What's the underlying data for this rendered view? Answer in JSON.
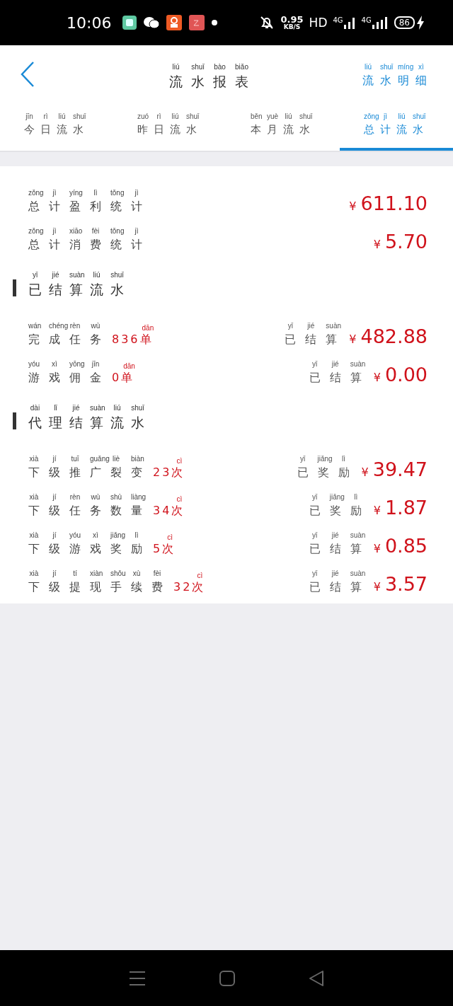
{
  "status_bar": {
    "time": "10:06",
    "speed": "0.95",
    "speed_unit": "KB/S",
    "hd": "HD",
    "network_1": "4G",
    "network_2": "4G",
    "battery": "86"
  },
  "header": {
    "title": {
      "text": "流水报表",
      "pinyin": "liú shuǐ bào biǎo"
    },
    "action": {
      "text": "流水明细",
      "pinyin": "liú shuǐ míng xì"
    }
  },
  "tabs": [
    {
      "text": "今日流水",
      "pinyin": "jīn rì liú shuǐ",
      "selected": false
    },
    {
      "text": "昨日流水",
      "pinyin": "zuó rì liú shuǐ",
      "selected": false
    },
    {
      "text": "本月流水",
      "pinyin": "běn yuè liú shuǐ",
      "selected": false
    },
    {
      "text": "总计流水",
      "pinyin": "zǒng jì liú shuǐ",
      "selected": true
    }
  ],
  "totals": [
    {
      "label": {
        "text": "总计盈利统计",
        "pinyin": "zǒng jì yíng lì tǒng jì"
      },
      "amount": {
        "currency": "¥",
        "value": "611.10"
      }
    },
    {
      "label": {
        "text": "总计消费统计",
        "pinyin": "zǒng jì xiāo fèi tǒng jì"
      },
      "amount": {
        "currency": "¥",
        "value": "5.70"
      }
    }
  ],
  "sections": [
    {
      "title": {
        "text": "已结算流水",
        "pinyin": "yǐ jié suàn liú shuǐ"
      },
      "rows": [
        {
          "label": {
            "text": "完成任务",
            "pinyin": "wán chéng rèn wù"
          },
          "count": {
            "text": "836单",
            "pinyin": "dān"
          },
          "status": {
            "text": "已结算",
            "pinyin": "yǐ jié suàn"
          },
          "amount": {
            "currency": "¥",
            "value": "482.88"
          }
        },
        {
          "label": {
            "text": "游戏佣金",
            "pinyin": "yóu xì yōng jīn"
          },
          "count": {
            "text": "0单",
            "pinyin": "dān"
          },
          "status": {
            "text": "已结算",
            "pinyin": "yǐ jié suàn"
          },
          "amount": {
            "currency": "¥",
            "value": "0.00"
          }
        }
      ]
    },
    {
      "title": {
        "text": "代理结算流水",
        "pinyin": "dài lǐ jié suàn liú shuǐ"
      },
      "rows": [
        {
          "label": {
            "text": "下级推广裂变",
            "pinyin": "xià jí tuī guǎng liè biàn"
          },
          "count": {
            "text": "23次",
            "pinyin": "cì"
          },
          "status": {
            "text": "已奖励",
            "pinyin": "yǐ jiǎng lì"
          },
          "amount": {
            "currency": "¥",
            "value": "39.47"
          }
        },
        {
          "label": {
            "text": "下级任务数量",
            "pinyin": "xià jí rèn wù shù liàng"
          },
          "count": {
            "text": "34次",
            "pinyin": "cì"
          },
          "status": {
            "text": "已奖励",
            "pinyin": "yǐ jiǎng lì"
          },
          "amount": {
            "currency": "¥",
            "value": "1.87"
          }
        },
        {
          "label": {
            "text": "下级游戏奖励",
            "pinyin": "xià jí yóu xì jiǎng lì"
          },
          "count": {
            "text": "5次",
            "pinyin": "cì"
          },
          "status": {
            "text": "已结算",
            "pinyin": "yǐ jié suàn"
          },
          "amount": {
            "currency": "¥",
            "value": "0.85"
          }
        },
        {
          "label": {
            "text": "下级提现手续费",
            "pinyin": "xià jí tí xiàn shǒu xù fèi"
          },
          "count": {
            "text": "32次",
            "pinyin": "cì"
          },
          "status": {
            "text": "已结算",
            "pinyin": "yǐ jié suàn"
          },
          "amount": {
            "currency": "¥",
            "value": "3.57"
          }
        }
      ]
    }
  ]
}
